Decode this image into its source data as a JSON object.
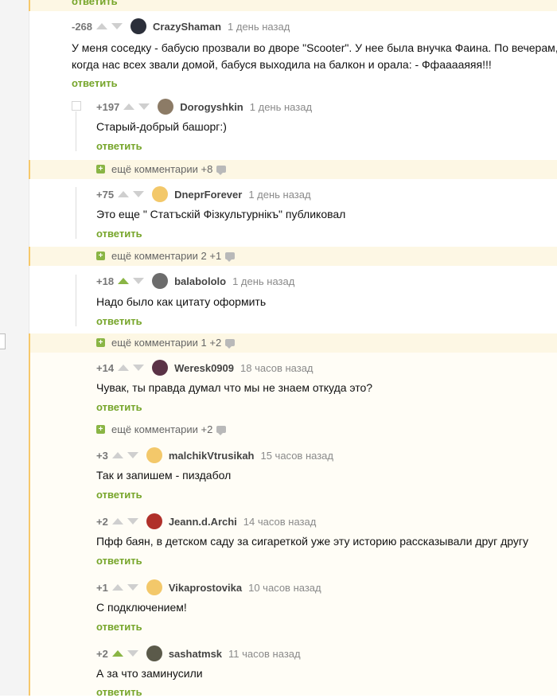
{
  "top": {
    "reply_label": "ответить"
  },
  "comments": [
    {
      "rating": "-268",
      "user": "CrazyShaman",
      "time": "1 день назад",
      "lines": [
        "У меня соседку - бабусю прозвали во дворе \"Scooter\". У нее была внучка Фаина. По вечерам,",
        "когда нас всех звали домой, бабуся выходила на балкон и орала: - Ффааааяяя!!!"
      ],
      "reply": "ответить",
      "upvoted": false,
      "avatar_color": "#2b2f3a"
    },
    {
      "rating": "+197",
      "user": "Dorogyshkin",
      "time": "1 день назад",
      "lines": [
        "Старый-добрый башорг:)"
      ],
      "reply": "ответить",
      "upvoted": false,
      "avatar_color": "#8c7b66"
    },
    {
      "rating": "+75",
      "user": "DneprForever",
      "time": "1 день назад",
      "lines": [
        "Это еще \" Статъскій Фізкультурнікъ\" публиковал"
      ],
      "reply": "ответить",
      "upvoted": false,
      "avatar_color": "#f3c86a"
    },
    {
      "rating": "+18",
      "user": "balabololo",
      "time": "1 день назад",
      "lines": [
        "Надо было как цитату оформить"
      ],
      "reply": "ответить",
      "upvoted": true,
      "avatar_color": "#6c6c6c"
    },
    {
      "rating": "+14",
      "user": "Weresk0909",
      "time": "18 часов назад",
      "lines": [
        "Чувак, ты правда думал что мы не знаем откуда это?"
      ],
      "reply": "ответить",
      "upvoted": false,
      "avatar_color": "#5a3246"
    },
    {
      "rating": "+3",
      "user": "malchikVtrusikah",
      "time": "15 часов назад",
      "lines": [
        "Так и запишем - пиздабол"
      ],
      "reply": "ответить",
      "upvoted": false,
      "avatar_color": "#f3c86a"
    },
    {
      "rating": "+2",
      "user": "Jeann.d.Archi",
      "time": "14 часов назад",
      "lines": [
        "Пфф баян, в детском саду за сигареткой уже эту историю рассказывали друг другу"
      ],
      "reply": "ответить",
      "upvoted": false,
      "avatar_color": "#b0302a"
    },
    {
      "rating": "+1",
      "user": "Vikaprostovika",
      "time": "10 часов назад",
      "lines": [
        "С подключением!"
      ],
      "reply": "ответить",
      "upvoted": false,
      "avatar_color": "#f3c86a"
    },
    {
      "rating": "+2",
      "user": "sashatmsk",
      "time": "11 часов назад",
      "lines": [
        "А за что заминусили"
      ],
      "reply": "ответить",
      "upvoted": true,
      "avatar_color": "#5b5a4a"
    }
  ],
  "more_comments": [
    {
      "label": "ещё комментарии +8"
    },
    {
      "label": "ещё комментарии 2 +1"
    },
    {
      "label": "ещё комментарии 1 +2"
    },
    {
      "label": "ещё комментарии +2"
    }
  ]
}
